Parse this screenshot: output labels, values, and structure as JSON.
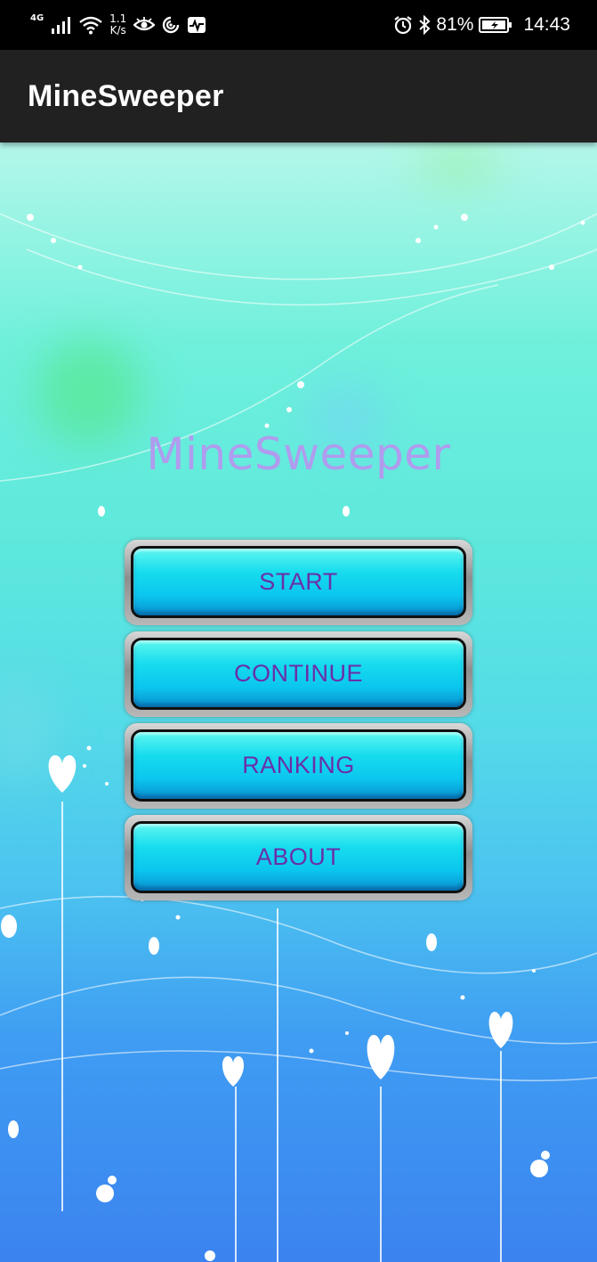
{
  "status_bar": {
    "network_type": "4G",
    "net_speed_value": "1.1",
    "net_speed_unit": "K/s",
    "battery_percent": "81%",
    "time": "14:43",
    "icons": [
      "signal-icon",
      "wifi-icon",
      "eye-icon",
      "swirl-icon",
      "activity-icon",
      "alarm-icon",
      "bluetooth-icon",
      "battery-icon"
    ]
  },
  "app_bar": {
    "title": "MineSweeper"
  },
  "main": {
    "game_title": "MineSweeper",
    "buttons": [
      {
        "label": "START"
      },
      {
        "label": "CONTINUE"
      },
      {
        "label": "RANKING"
      },
      {
        "label": "ABOUT"
      }
    ]
  },
  "colors": {
    "app_bar": "#212121",
    "title_text": "#b09cee",
    "button_text": "#6a2fa8",
    "button_face": "#17dcee"
  }
}
